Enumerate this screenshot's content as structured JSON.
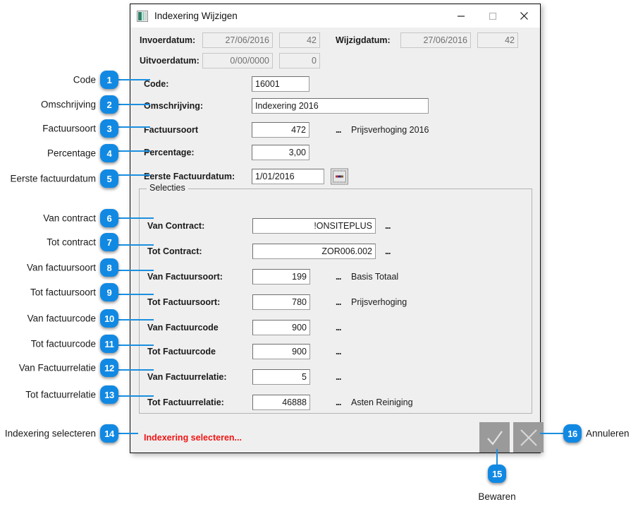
{
  "window": {
    "title": "Indexering Wijzigen",
    "icon": "app-window-icon",
    "minimize_label": "—",
    "maximize_label": "□",
    "close_label": "×"
  },
  "header": {
    "invoerdatum_label": "Invoerdatum:",
    "invoerdatum_value": "27/06/2016",
    "invoerdatum_user": "42",
    "uitvoerdatum_label": "Uitvoerdatum:",
    "uitvoerdatum_value": "0/00/0000",
    "uitvoerdatum_user": "0",
    "wijzigdatum_label": "Wijzigdatum:",
    "wijzigdatum_value": "27/06/2016",
    "wijzigdatum_user": "42"
  },
  "form": {
    "code_label": "Code:",
    "code_value": "16001",
    "omschrijving_label": "Omschrijving:",
    "omschrijving_value": "Indexering 2016",
    "factuursoort_label": "Factuursoort",
    "factuursoort_value": "472",
    "factuursoort_dots": "...",
    "factuursoort_desc": "Prijsverhoging 2016",
    "percentage_label": "Percentage:",
    "percentage_value": "3,00",
    "eerste_factuurdatum_label": "Eerste Factuurdatum:",
    "eerste_factuurdatum_value": "1/01/2016"
  },
  "selecties": {
    "title": "Selecties",
    "rows": [
      {
        "label": "Van Contract:",
        "value": "!ONSITEPLUS",
        "dots": "...",
        "desc": "",
        "wide": true
      },
      {
        "label": "Tot Contract:",
        "value": "ZOR006.002",
        "dots": "...",
        "desc": "",
        "wide": true
      },
      {
        "label": "Van Factuursoort:",
        "value": "199",
        "dots": "...",
        "desc": "Basis Totaal",
        "wide": false
      },
      {
        "label": "Tot Factuursoort:",
        "value": "780",
        "dots": "...",
        "desc": "Prijsverhoging",
        "wide": false
      },
      {
        "label": "Van Factuurcode",
        "value": "900",
        "dots": "...",
        "desc": "",
        "wide": false
      },
      {
        "label": "Tot Factuurcode",
        "value": "900",
        "dots": "...",
        "desc": "",
        "wide": false
      },
      {
        "label": "Van Factuurrelatie:",
        "value": "5",
        "dots": "...",
        "desc": "",
        "wide": false
      },
      {
        "label": "Tot Factuurrelatie:",
        "value": "46888",
        "dots": "...",
        "desc": "Asten Reiniging",
        "wide": false
      }
    ]
  },
  "footer": {
    "status_message": "Indexering selecteren...",
    "save_icon": "checkmark-icon",
    "cancel_icon": "cross-icon"
  },
  "annotations": {
    "accent_color": "#1189e3",
    "items": [
      {
        "num": "1",
        "text": "Code"
      },
      {
        "num": "2",
        "text": "Omschrijving"
      },
      {
        "num": "3",
        "text": "Factuursoort"
      },
      {
        "num": "4",
        "text": "Percentage"
      },
      {
        "num": "5",
        "text": "Eerste factuurdatum"
      },
      {
        "num": "6",
        "text": "Van contract"
      },
      {
        "num": "7",
        "text": "Tot contract"
      },
      {
        "num": "8",
        "text": "Van factuursoort"
      },
      {
        "num": "9",
        "text": "Tot factuursoort"
      },
      {
        "num": "10",
        "text": "Van factuurcode"
      },
      {
        "num": "11",
        "text": "Tot factuurcode"
      },
      {
        "num": "12",
        "text": "Van Factuurrelatie"
      },
      {
        "num": "13",
        "text": "Tot factuurrelatie"
      },
      {
        "num": "14",
        "text": "Indexering selecteren"
      },
      {
        "num": "15",
        "text": "Bewaren"
      },
      {
        "num": "16",
        "text": "Annuleren"
      }
    ]
  }
}
